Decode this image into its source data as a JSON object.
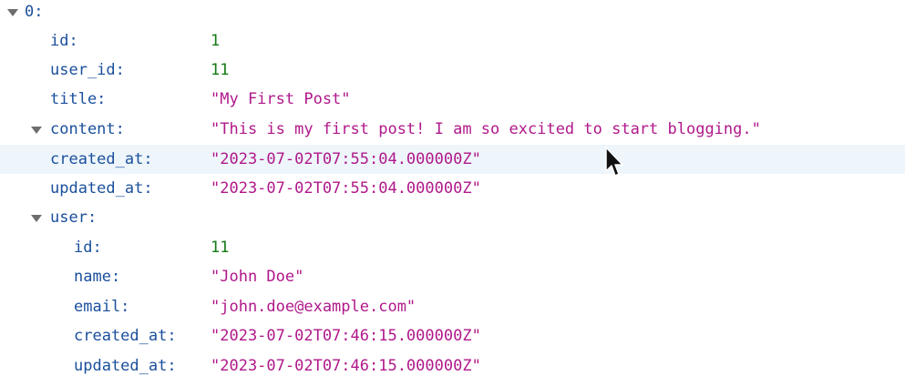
{
  "root": {
    "index_label": "0:"
  },
  "fields": [
    {
      "key": "id:",
      "value": "1",
      "type": "number"
    },
    {
      "key": "user_id:",
      "value": "11",
      "type": "number"
    },
    {
      "key": "title:",
      "value": "\"My First Post\"",
      "type": "string"
    },
    {
      "key": "content:",
      "value": "\"This is my first post! I am so excited to start blogging.\"",
      "type": "string"
    },
    {
      "key": "created_at:",
      "value": "\"2023-07-02T07:55:04.000000Z\"",
      "type": "string"
    },
    {
      "key": "updated_at:",
      "value": "\"2023-07-02T07:55:04.000000Z\"",
      "type": "string"
    }
  ],
  "user": {
    "key": "user:",
    "fields": [
      {
        "key": "id:",
        "value": "11",
        "type": "number"
      },
      {
        "key": "name:",
        "value": "\"John Doe\"",
        "type": "string"
      },
      {
        "key": "email:",
        "value": "\"john.doe@example.com\"",
        "type": "string"
      },
      {
        "key": "created_at:",
        "value": "\"2023-07-02T07:46:15.000000Z\"",
        "type": "string"
      },
      {
        "key": "updated_at:",
        "value": "\"2023-07-02T07:46:15.000000Z\"",
        "type": "string"
      }
    ]
  },
  "colors": {
    "key": "#1a4f9c",
    "number": "#137a14",
    "string": "#b0188a",
    "hover_row": "#eef6fb"
  }
}
